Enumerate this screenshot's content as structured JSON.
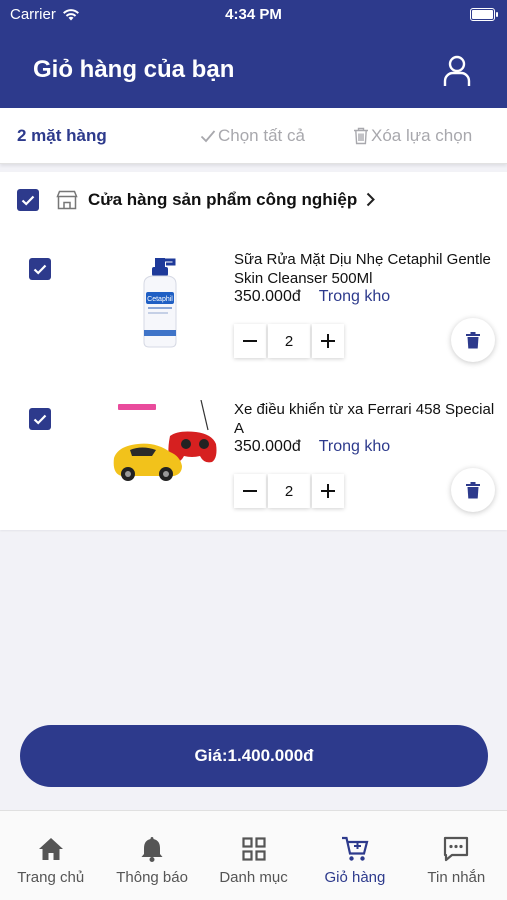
{
  "status_bar": {
    "carrier": "Carrier",
    "time": "4:34 PM"
  },
  "header": {
    "title": "Giỏ hàng của bạn"
  },
  "select_bar": {
    "count": "2 mặt hàng",
    "select_all": "Chọn tất cả",
    "delete_selected": "Xóa lựa chọn"
  },
  "shop": {
    "name": "Cửa hàng sản phẩm công nghiệp",
    "checked": true
  },
  "items": [
    {
      "name": "Sữa Rửa Mặt Dịu Nhẹ Cetaphil Gentle Skin Cleanser 500Ml",
      "price": "350.000đ",
      "stock": "Trong kho",
      "quantity": "2",
      "checked": true,
      "image": "cetaphil-bottle",
      "image_brand": "Cetaphil"
    },
    {
      "name": "Xe điều khiển từ xa Ferrari 458 Special A",
      "price": "350.000đ",
      "stock": "Trong kho",
      "quantity": "2",
      "checked": true,
      "image": "ferrari-rc-car",
      "image_brand": "Ferrari"
    }
  ],
  "checkout": {
    "label": "Giá:1.400.000đ"
  },
  "tabs": [
    {
      "label": "Trang chủ",
      "icon": "home-icon",
      "active": false
    },
    {
      "label": "Thông báo",
      "icon": "bell-icon",
      "active": false
    },
    {
      "label": "Danh mục",
      "icon": "grid-icon",
      "active": false
    },
    {
      "label": "Giỏ hàng",
      "icon": "cart-icon",
      "active": true
    },
    {
      "label": "Tin nhắn",
      "icon": "message-icon",
      "active": false
    }
  ],
  "colors": {
    "primary": "#2d3a8c",
    "background": "#f2f2f7",
    "muted": "#a8a8ad"
  }
}
